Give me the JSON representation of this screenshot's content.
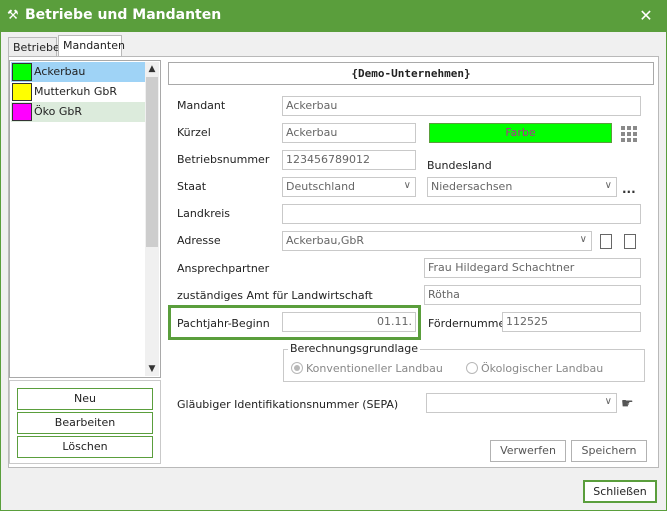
{
  "window": {
    "title": "Betriebe und Mandanten",
    "close": "✕"
  },
  "tabs": [
    {
      "label": "Betriebe"
    },
    {
      "label": "Mandanten"
    }
  ],
  "list": {
    "items": [
      {
        "label": "Ackerbau",
        "color": "#00ff00"
      },
      {
        "label": "Mutterkuh GbR",
        "color": "#ffff00"
      },
      {
        "label": "Öko GbR",
        "color": "#ff00ff"
      }
    ]
  },
  "buttons": {
    "neu": "Neu",
    "bearbeiten": "Bearbeiten",
    "loeschen": "Löschen",
    "verwerfen": "Verwerfen",
    "speichern": "Speichern",
    "schliessen": "Schließen"
  },
  "header": {
    "title": "{Demo-Unternehmen}"
  },
  "form": {
    "mandant_label": "Mandant",
    "mandant_value": "Ackerbau",
    "kuerzel_label": "Kürzel",
    "kuerzel_value": "Ackerbau",
    "farbe_label": "Farbe",
    "farbe_color": "#00ff00",
    "betriebsnummer_label": "Betriebsnummer",
    "betriebsnummer_value": "123456789012",
    "bundesland_label": "Bundesland",
    "bundesland_value": "Niedersachsen",
    "staat_label": "Staat",
    "staat_value": "Deutschland",
    "ellipsis": "...",
    "landkreis_label": "Landkreis",
    "landkreis_value": "",
    "adresse_label": "Adresse",
    "adresse_value": "Ackerbau,GbR",
    "ansprechpartner_label": "Ansprechpartner",
    "ansprechpartner_value": "Frau Hildegard Schachtner",
    "amt_label": "zuständiges Amt für Landwirtschaft",
    "amt_value": "Rötha",
    "pachtjahr_label": "Pachtjahr-Beginn",
    "pachtjahr_value": "01.11.",
    "foerdernummer_label": "Fördernummer",
    "foerdernummer_value": "112525",
    "berechnung_title": "Berechnungsgrundlage",
    "radio_konventionell": "Konventioneller Landbau",
    "radio_oekologisch": "Ökologischer Landbau",
    "sepa_label": "Gläubiger Identifikationsnummer (SEPA)",
    "sepa_value": ""
  },
  "colors": {
    "accent": "#5a9e3c",
    "selection": "#9fd3f6"
  }
}
